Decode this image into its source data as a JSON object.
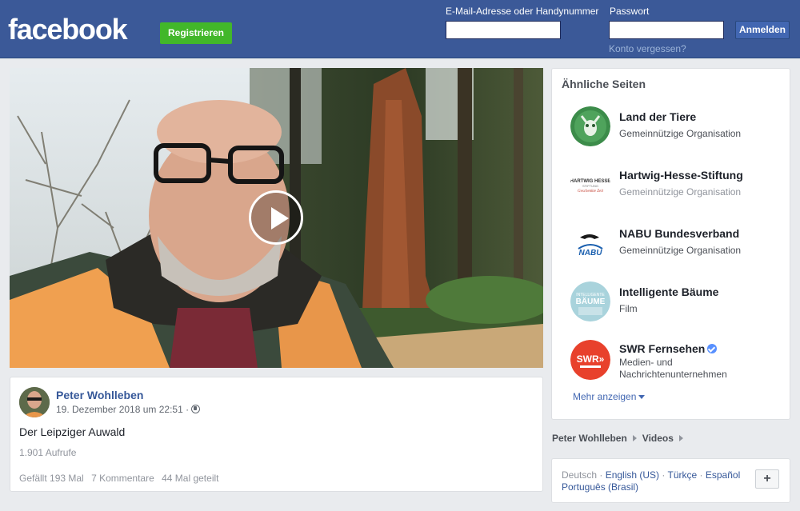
{
  "header": {
    "logo": "facebook",
    "register_label": "Registrieren",
    "email_label": "E-Mail-Adresse oder Handynummer",
    "password_label": "Passwort",
    "login_label": "Anmelden",
    "forgot_label": "Konto vergessen?"
  },
  "post": {
    "author": "Peter Wohlleben",
    "date": "19. Dezember 2018 um 22:51 ·",
    "text": "Der Leipziger Auwald",
    "views": "1.901 Aufrufe",
    "likes": "Gefällt 193 Mal",
    "comments": "7 Kommentare",
    "shares": "44 Mal geteilt"
  },
  "similar": {
    "title": "Ähnliche Seiten",
    "items": [
      {
        "name": "Land der Tiere",
        "category": "Gemeinnützige Organisation",
        "logo_text": ""
      },
      {
        "name": "Hartwig-Hesse-Stiftung",
        "category": "Gemeinnützige Organisation",
        "logo_text": "HARTWIG HESSE"
      },
      {
        "name": "NABU Bundesverband",
        "category": "Gemeinnützige Organisation",
        "logo_text": "NABU"
      },
      {
        "name": "Intelligente Bäume",
        "category": "Film",
        "logo_text": "BÄUME"
      },
      {
        "name": "SWR Fernsehen",
        "category": "Medien- und Nachrichtenunternehmen",
        "logo_text": "SWR»"
      }
    ],
    "more_label": "Mehr anzeigen"
  },
  "breadcrumb": {
    "page": "Peter Wohlleben",
    "section": "Videos"
  },
  "languages": {
    "current": "Deutsch",
    "sep": " · ",
    "links": [
      "English (US)",
      "Türkçe",
      "Español",
      "Português (Brasil)"
    ],
    "add_label": "+"
  },
  "colors": {
    "brand": "#3b5998",
    "register": "#42b72a",
    "link": "#365899"
  }
}
